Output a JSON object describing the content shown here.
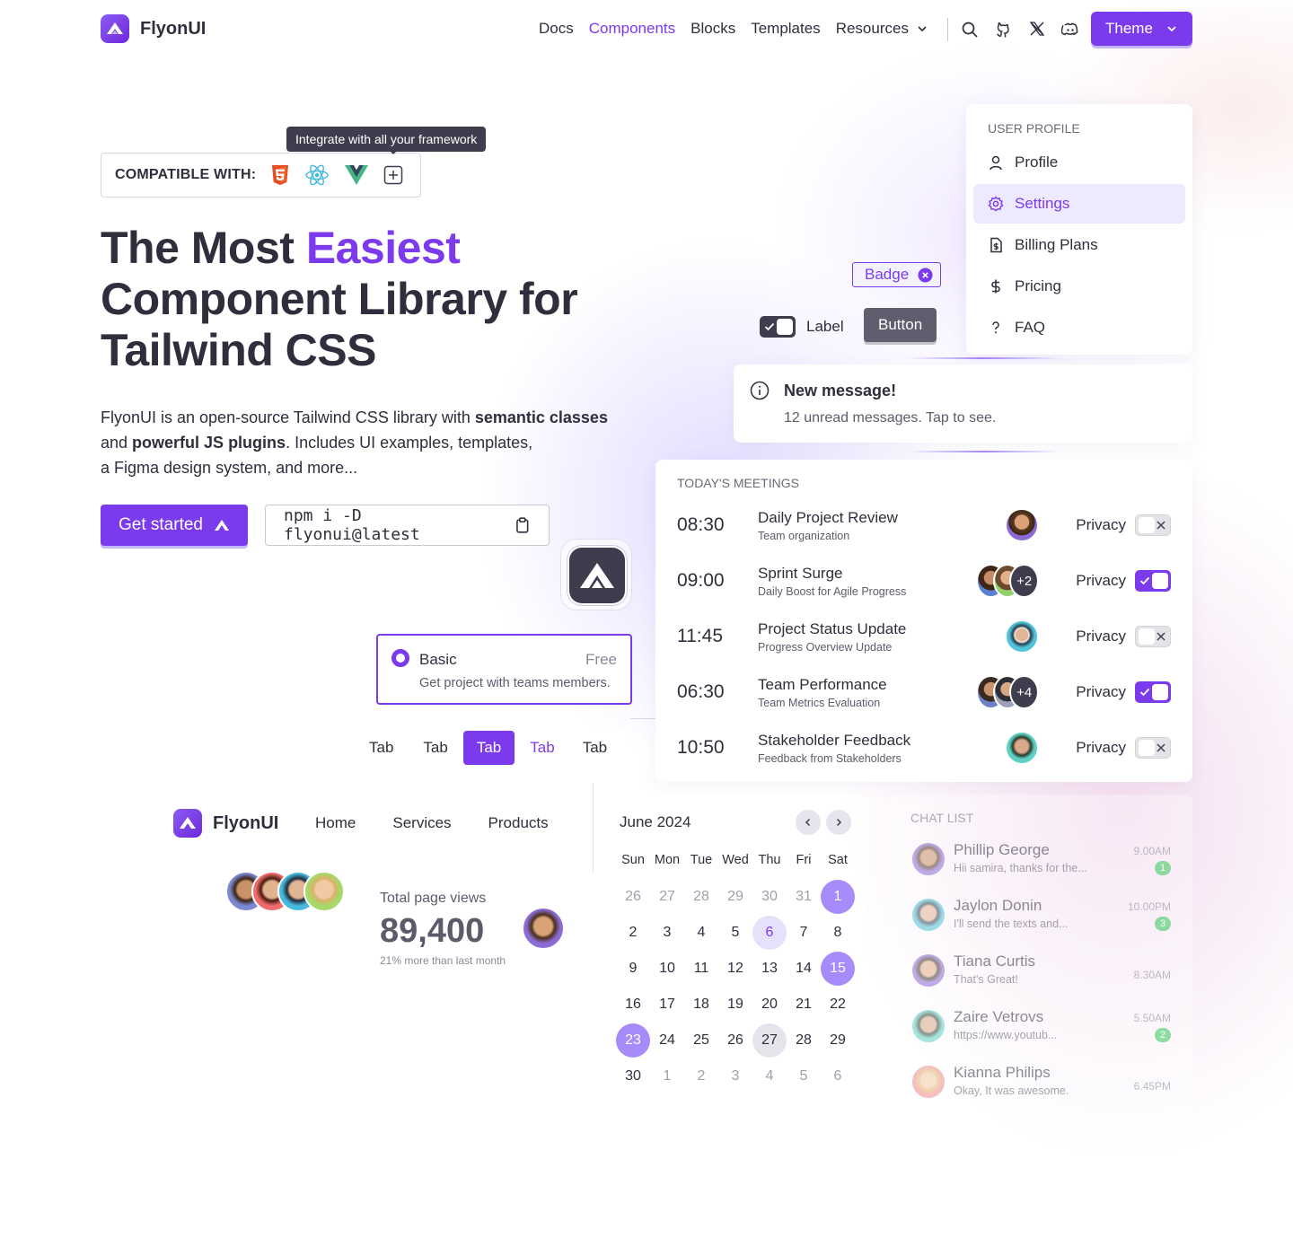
{
  "nav": {
    "brand": "FlyonUI",
    "links": [
      "Docs",
      "Components",
      "Blocks",
      "Templates",
      "Resources"
    ],
    "active": "Components",
    "theme_label": "Theme"
  },
  "hero": {
    "tooltip": "Integrate with all your framework",
    "compatible_label": "COMPATIBLE WITH:",
    "title_part1": "The Most ",
    "title_highlight": "Easiest",
    "title_line2": "Component Library for",
    "title_line3": "Tailwind CSS",
    "desc_part1": "FlyonUI is an open-source Tailwind CSS library with ",
    "desc_bold1": "semantic classes",
    "desc_part2": "and ",
    "desc_bold2": "powerful JS plugins",
    "desc_part3": ". Includes UI examples, templates,",
    "desc_part4": "a Figma design system, and more...",
    "cta_label": "Get started",
    "npm_command": "npm i -D flyonui@latest"
  },
  "profile_menu": {
    "heading": "USER PROFILE",
    "items": [
      "Profile",
      "Settings",
      "Billing Plans",
      "Pricing",
      "FAQ"
    ],
    "active": "Settings"
  },
  "badge": {
    "label": "Badge"
  },
  "switch": {
    "label": "Label"
  },
  "button": {
    "label": "Button"
  },
  "alert": {
    "title": "New message!",
    "body": "12 unread messages. Tap to see."
  },
  "meetings": {
    "heading": "TODAY'S MEETINGS",
    "privacy_label": "Privacy",
    "rows": [
      {
        "time": "08:30",
        "title": "Daily Project Review",
        "sub": "Team organization",
        "extra": "",
        "privacy": false
      },
      {
        "time": "09:00",
        "title": "Sprint Surge",
        "sub": "Daily Boost for Agile Progress",
        "extra": "+2",
        "privacy": true
      },
      {
        "time": "11:45",
        "title": "Project Status Update",
        "sub": "Progress Overview Update",
        "extra": "",
        "privacy": false
      },
      {
        "time": "06:30",
        "title": "Team Performance",
        "sub": "Team Metrics Evaluation",
        "extra": "+4",
        "privacy": true
      },
      {
        "time": "10:50",
        "title": "Stakeholder Feedback",
        "sub": "Feedback from Stakeholders",
        "extra": "",
        "privacy": false
      }
    ]
  },
  "plan": {
    "name": "Basic",
    "price": "Free",
    "desc": "Get project with teams members."
  },
  "tabs": {
    "items": [
      "Tab",
      "Tab",
      "Tab",
      "Tab",
      "Tab"
    ],
    "active_index": 2,
    "hover_index": 3
  },
  "mini_nav": {
    "brand": "FlyonUI",
    "links": [
      "Home",
      "Services",
      "Products"
    ]
  },
  "stats": {
    "label": "Total page views",
    "value": "89,400",
    "note": "21% more than last month"
  },
  "calendar": {
    "month": "June 2024",
    "weekdays": [
      "Sun",
      "Mon",
      "Tue",
      "Wed",
      "Thu",
      "Fri",
      "Sat"
    ],
    "days": [
      "26",
      "27",
      "28",
      "29",
      "30",
      "31",
      "1",
      "2",
      "3",
      "4",
      "5",
      "6",
      "7",
      "8",
      "9",
      "10",
      "11",
      "12",
      "13",
      "14",
      "15",
      "16",
      "17",
      "18",
      "19",
      "20",
      "21",
      "22",
      "23",
      "24",
      "25",
      "26",
      "27",
      "28",
      "29",
      "30",
      "1",
      "2",
      "3",
      "4",
      "5",
      "6"
    ],
    "muted_indices": [
      0,
      1,
      2,
      3,
      4,
      5,
      36,
      37,
      38,
      39,
      40,
      41
    ],
    "selected_indices": [
      6,
      20,
      28
    ],
    "today_index": 11,
    "hover_index": 32
  },
  "chat": {
    "heading": "CHAT LIST",
    "rows": [
      {
        "name": "Phillip George",
        "msg": "Hii samira, thanks for the...",
        "time": "9.00AM",
        "count": "1"
      },
      {
        "name": "Jaylon Donin",
        "msg": "I'll send the texts and...",
        "time": "10.00PM",
        "count": "3"
      },
      {
        "name": "Tiana Curtis",
        "msg": "That's Great!",
        "time": "8.30AM",
        "count": ""
      },
      {
        "name": "Zaire Vetrovs",
        "msg": "https://www.youtub...",
        "time": "5.50AM",
        "count": "2"
      },
      {
        "name": "Kianna Philips",
        "msg": "Okay, It was awesome.",
        "time": "6.45PM",
        "count": ""
      }
    ]
  },
  "colors": {
    "primary": "#7c3aed",
    "text": "#2f2e3d",
    "success": "#34c759"
  }
}
